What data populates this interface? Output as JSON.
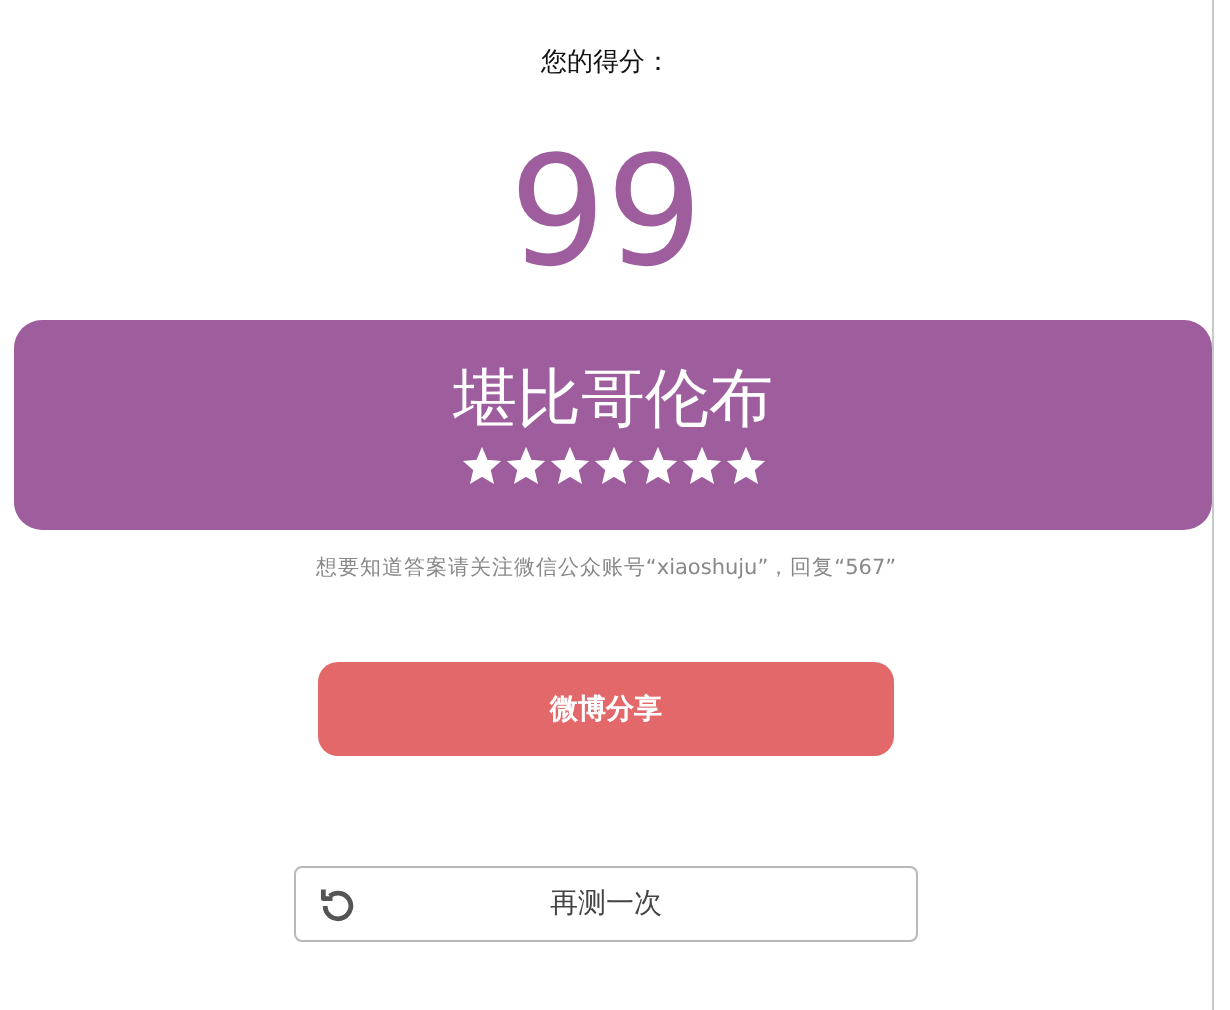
{
  "score_label": "您的得分：",
  "score": "99",
  "result": {
    "title": "堪比哥伦布",
    "stars": 7
  },
  "note": "想要知道答案请关注微信公众账号“xiaoshuju”，回复“567”",
  "share_button": "微博分享",
  "retry_button": "再测一次"
}
